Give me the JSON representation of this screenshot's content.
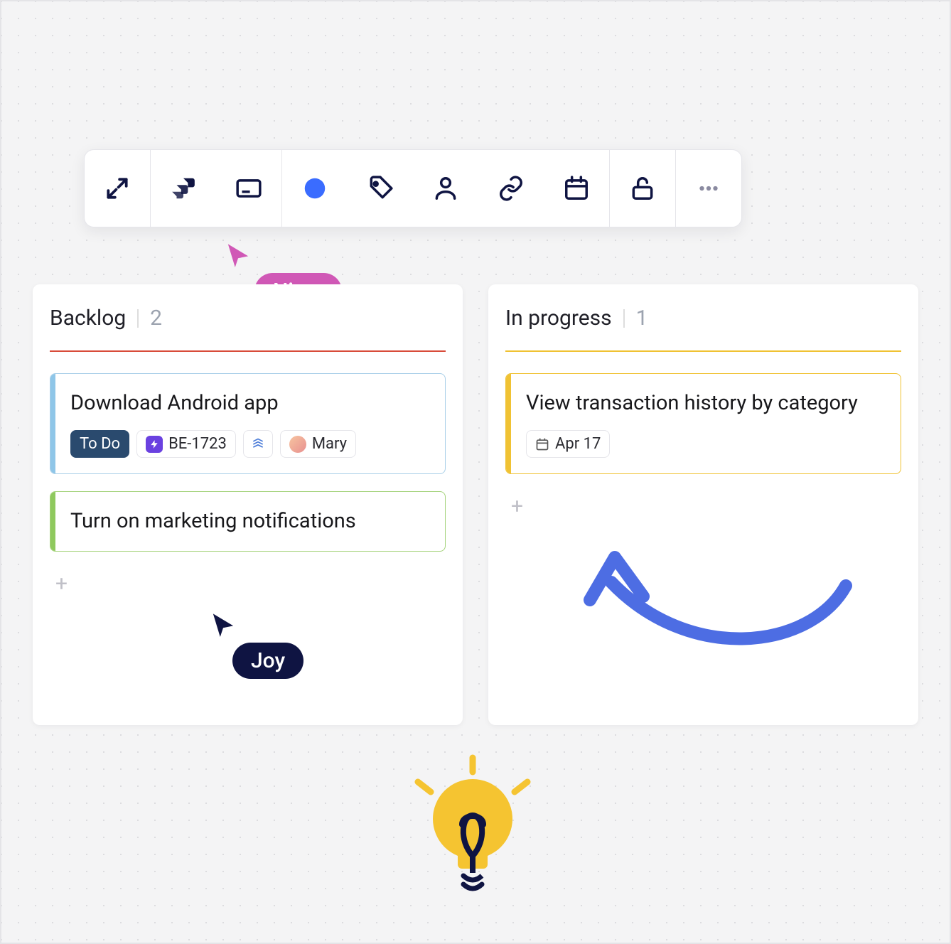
{
  "toolbar": {
    "icons": [
      "expand-icon",
      "jira-icon",
      "text-card-icon",
      "color-dot-icon",
      "tag-icon",
      "person-icon",
      "link-icon",
      "calendar-icon",
      "lock-open-icon",
      "more-icon"
    ]
  },
  "cursors": {
    "nima": {
      "label": "Nima",
      "color": "pink"
    },
    "joy": {
      "label": "Joy",
      "color": "navy"
    }
  },
  "board": {
    "columns": [
      {
        "id": "backlog",
        "title": "Backlog",
        "count": "2",
        "rule_color": "red",
        "cards": [
          {
            "accent": "blue",
            "title": "Download Android app",
            "chips": [
              {
                "kind": "status",
                "label": "To Do"
              },
              {
                "kind": "ticket",
                "icon": "bolt",
                "label": "BE-1723"
              },
              {
                "kind": "icon-only",
                "icon": "layers"
              },
              {
                "kind": "assignee",
                "avatar": true,
                "label": "Mary"
              }
            ]
          },
          {
            "accent": "green",
            "title": "Turn on marketing notifications",
            "chips": []
          }
        ]
      },
      {
        "id": "in-progress",
        "title": "In progress",
        "count": "1",
        "rule_color": "yellow",
        "cards": [
          {
            "accent": "yellow",
            "title": "View transaction history by category",
            "chips": [
              {
                "kind": "date",
                "icon": "calendar",
                "label": "Apr 17"
              }
            ]
          }
        ]
      }
    ]
  }
}
